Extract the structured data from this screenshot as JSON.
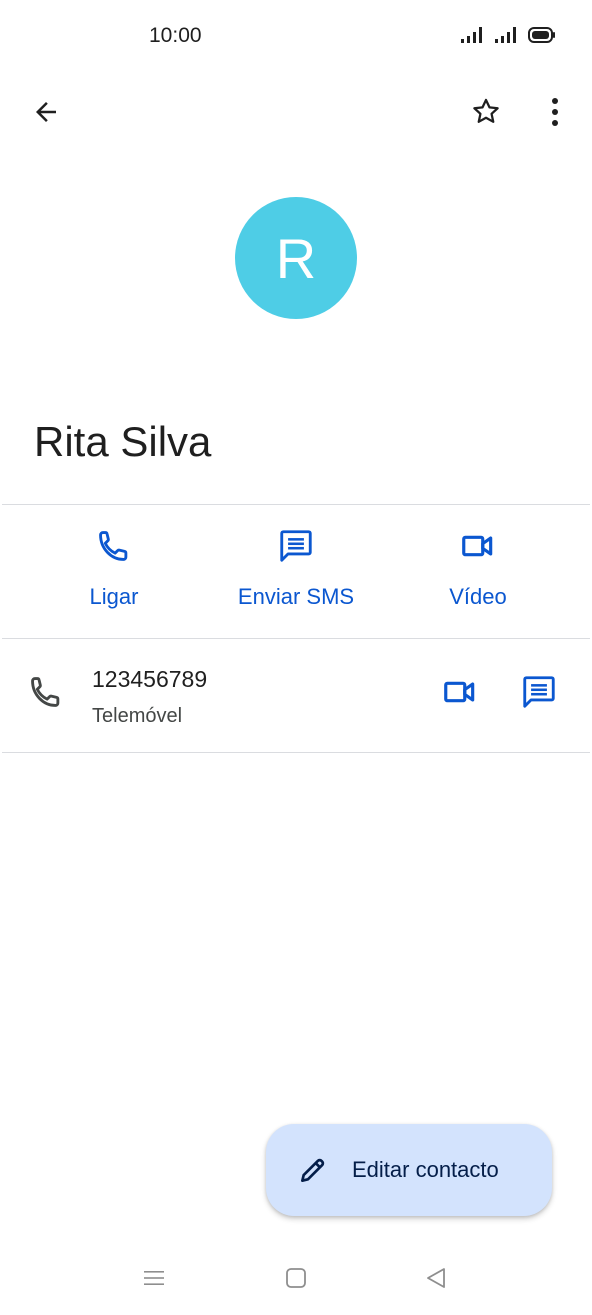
{
  "status_bar": {
    "time": "10:00",
    "icons": [
      "signal-icon",
      "signal-icon",
      "battery-icon"
    ]
  },
  "top_bar": {
    "icons": [
      "arrow-back-icon",
      "star-outline-icon",
      "more-vert-icon"
    ]
  },
  "contact": {
    "avatar_letter": "R",
    "avatar_color": "#4ecde6",
    "name": "Rita Silva"
  },
  "actions": [
    {
      "label": "Ligar",
      "icon": "phone-icon"
    },
    {
      "label": "Enviar SMS",
      "icon": "message-icon"
    },
    {
      "label": "Vídeo",
      "icon": "videocam-icon"
    }
  ],
  "phone_entry": {
    "number": "123456789",
    "type": "Telemóvel",
    "icons": [
      "phone-icon",
      "videocam-icon",
      "message-icon"
    ]
  },
  "fab": {
    "label": "Editar contacto",
    "icon": "pencil-icon"
  },
  "colors": {
    "accent": "#0b57d0",
    "fab_background": "#d3e3fd",
    "divider": "#dadce0"
  },
  "nav_bar": {
    "icons": [
      "menu-icon",
      "home-icon",
      "back-triangle-icon"
    ]
  }
}
